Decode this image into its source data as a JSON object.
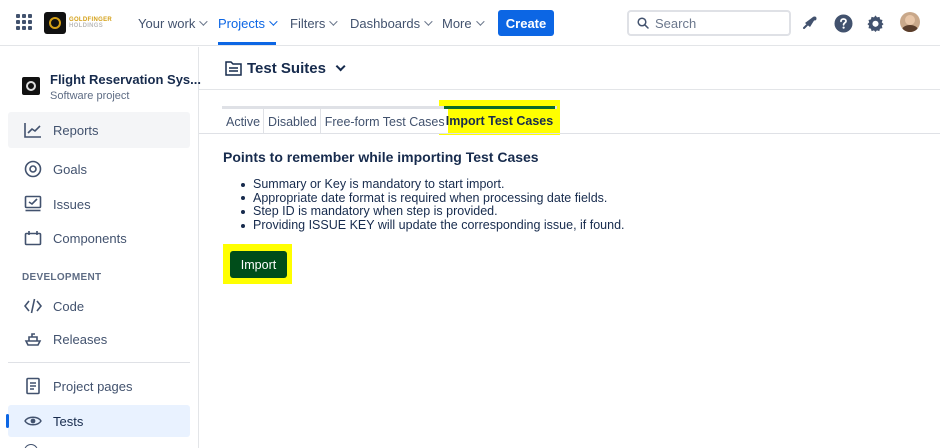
{
  "topnav": {
    "logo_lines": [
      "GOLDFINGER",
      "HOLDINGS"
    ],
    "items": [
      {
        "label": "Your work"
      },
      {
        "label": "Projects"
      },
      {
        "label": "Filters"
      },
      {
        "label": "Dashboards"
      },
      {
        "label": "More"
      }
    ],
    "active_item": "Projects",
    "create_label": "Create",
    "search_placeholder": "Search",
    "icons": [
      "apps-grid-icon",
      "notifications-icon",
      "help-icon",
      "settings-icon",
      "avatar"
    ],
    "accent_color": "#0c66e4"
  },
  "sidebar": {
    "project_name": "Flight Reservation Sys...",
    "project_type": "Software project",
    "items": [
      {
        "label": "Reports",
        "icon": "reports-icon"
      },
      {
        "label": "Goals",
        "icon": "goals-icon"
      },
      {
        "label": "Issues",
        "icon": "issues-icon"
      },
      {
        "label": "Components",
        "icon": "components-icon"
      },
      {
        "label": "Code",
        "icon": "code-icon"
      },
      {
        "label": "Releases",
        "icon": "releases-icon"
      },
      {
        "label": "Project pages",
        "icon": "project-pages-icon"
      },
      {
        "label": "Tests",
        "icon": "tests-icon"
      }
    ],
    "section_development": "DEVELOPMENT",
    "active_item": "Tests"
  },
  "main": {
    "title": "Test Suites",
    "tabs": [
      {
        "label": "Active"
      },
      {
        "label": "Disabled"
      },
      {
        "label": "Free-form Test Cases"
      },
      {
        "label": "Import Test Cases"
      }
    ],
    "active_tab": "Import Test Cases",
    "heading": "Points to remember while importing Test Cases",
    "points": [
      "Summary or Key is mandatory to start import.",
      "Appropriate date format is required when processing date fields.",
      "Step ID is mandatory when step is provided.",
      "Providing ISSUE KEY will update the corresponding issue, if found."
    ],
    "import_label": "Import",
    "highlight_color": "#ffff00",
    "import_button_color": "#004d1a"
  }
}
